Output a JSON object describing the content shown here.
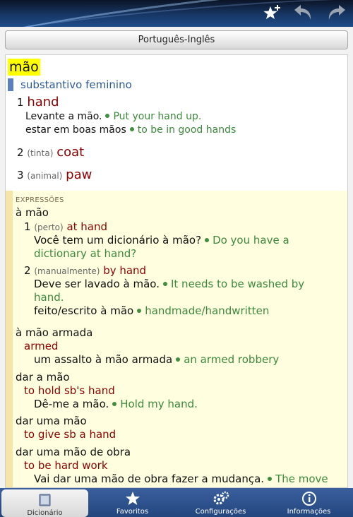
{
  "header": {
    "icons": [
      "star-add-icon",
      "back-arrow-icon",
      "forward-arrow-icon"
    ]
  },
  "language_pair": "Português-Inglês",
  "entry": {
    "headword": "mão",
    "pos": "substantivo feminino",
    "senses": [
      {
        "num": "1",
        "gloss": "",
        "translation": "hand",
        "examples": [
          {
            "src": "Levante a mão.",
            "tgt": "Put your hand up."
          },
          {
            "src": "estar em boas mãos",
            "tgt": "to be in good hands"
          }
        ]
      },
      {
        "num": "2",
        "gloss": "(tinta)",
        "translation": "coat"
      },
      {
        "num": "3",
        "gloss": "(animal)",
        "translation": "paw"
      }
    ]
  },
  "expressions": {
    "label": "EXPRESSÕES",
    "a_mao": {
      "phrase": "à mão",
      "s1": {
        "num": "1",
        "gloss": "(perto)",
        "tr": "at hand",
        "ex_src": "Você tem um dicionário à mão?",
        "ex_tgt1": "Do you have a",
        "ex_tgt2": "dictionary at hand?"
      },
      "s2": {
        "num": "2",
        "gloss": "(manualmente)",
        "tr": "by hand",
        "ex1_src": "Deve ser lavado à mão.",
        "ex1_tgt1": "It needs to be washed by",
        "ex1_tgt2": "hand.",
        "ex2_src": "feito/escrito à mão",
        "ex2_tgt": "handmade/handwritten"
      }
    },
    "armada": {
      "phrase": "à mão armada",
      "tr": "armed",
      "ex_src": "um assalto à mão armada",
      "ex_tgt": "an armed robbery"
    },
    "dar_a_mao": {
      "phrase": "dar a mão",
      "tr": "to hold sb's hand",
      "ex_src": "Dê-me a mão.",
      "ex_tgt": "Hold my hand."
    },
    "dar_uma_mao": {
      "phrase": "dar uma mão",
      "tr": "to give sb a hand"
    },
    "obra": {
      "phrase": "dar uma mão de obra",
      "tr": "to be hard work",
      "ex_src": "Vai dar uma mão de obra fazer a mudança.",
      "ex_tgt": "The move"
    }
  },
  "tabs": [
    {
      "label": "Dicionário",
      "icon": "book-icon",
      "active": true
    },
    {
      "label": "Favoritos",
      "icon": "star-icon"
    },
    {
      "label": "Configurações",
      "icon": "gears-icon"
    },
    {
      "label": "Informações",
      "icon": "info-icon"
    }
  ]
}
